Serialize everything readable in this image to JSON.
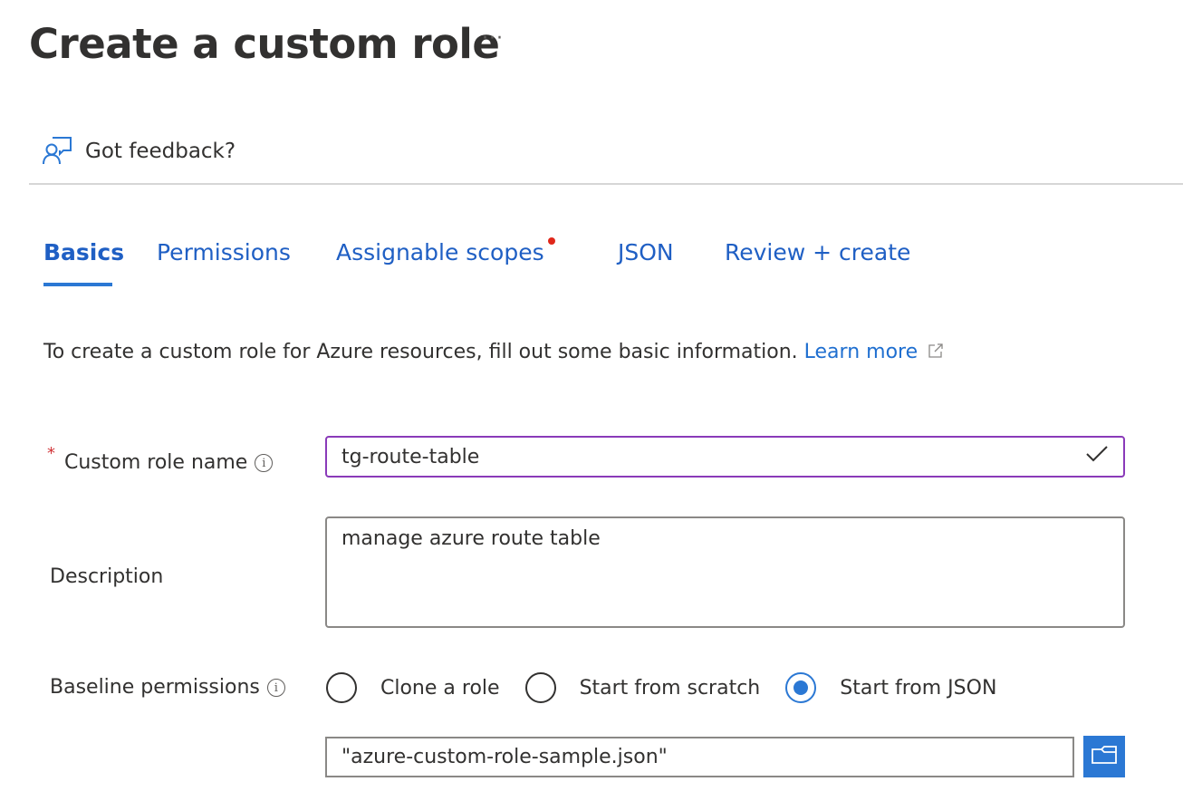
{
  "header": {
    "title": "Create a custom role",
    "more_label": "···",
    "feedback_label": "Got feedback?"
  },
  "tabs": [
    {
      "label": "Basics",
      "active": true,
      "has_error": false
    },
    {
      "label": "Permissions",
      "active": false,
      "has_error": false
    },
    {
      "label": "Assignable scopes",
      "active": false,
      "has_error": true
    },
    {
      "label": "JSON",
      "active": false,
      "has_error": false
    },
    {
      "label": "Review + create",
      "active": false,
      "has_error": false
    }
  ],
  "intro": {
    "text": "To create a custom role for Azure resources, fill out some basic information. ",
    "link_label": "Learn more",
    "link_icon": "external-link-icon"
  },
  "form": {
    "role_name": {
      "label": "Custom role name",
      "required_marker": "*",
      "info_icon": "i",
      "value": "tg-route-table",
      "valid": true
    },
    "description": {
      "label": "Description",
      "value": "manage azure route table"
    },
    "baseline": {
      "label": "Baseline permissions",
      "info_icon": "i",
      "options": [
        {
          "label": "Clone a role",
          "selected": false
        },
        {
          "label": "Start from scratch",
          "selected": false
        },
        {
          "label": "Start from JSON",
          "selected": true
        }
      ],
      "file_value": "\"azure-custom-role-sample.json\"",
      "browse_icon": "folder-open-icon"
    }
  },
  "colors": {
    "accent": "#2b78d4",
    "link": "#1f5fc4",
    "focus_border": "#8a3ab9",
    "error_dot": "#e0271a",
    "required": "#d13438"
  }
}
